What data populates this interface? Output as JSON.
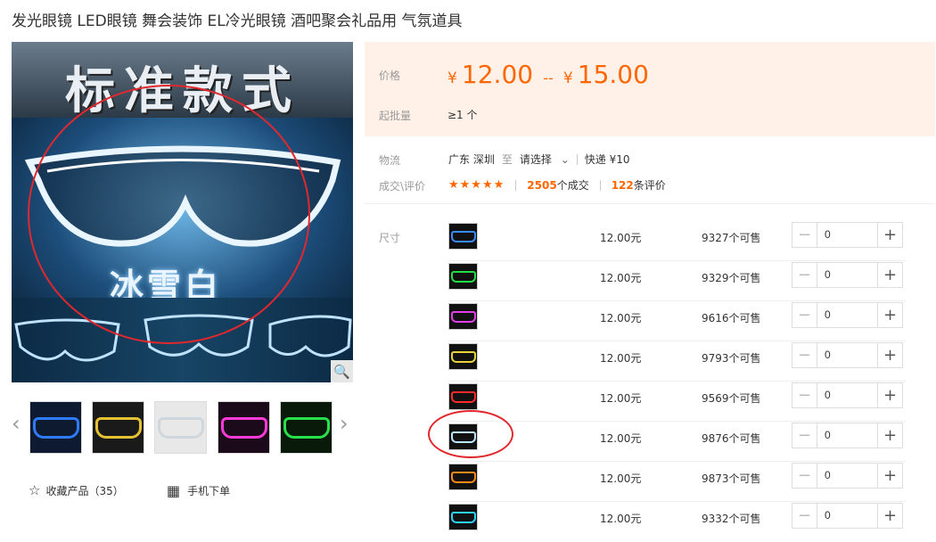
{
  "product": {
    "title": "发光眼镜 LED眼镜 舞会装饰 EL冷光眼镜 酒吧聚会礼品用 气氛道具",
    "banner_text": "标准款式",
    "variant_text": "冰雪白"
  },
  "price": {
    "label": "价格",
    "currency": "¥",
    "min": "12.00",
    "separator": "--",
    "max": "15.00"
  },
  "moq": {
    "label": "起批量",
    "value": "≥1 个"
  },
  "shipping": {
    "label": "物流",
    "origin": "广东 深圳",
    "to": "至",
    "dest": "请选择",
    "method": "快递 ¥10"
  },
  "reviews": {
    "label": "成交\\评价",
    "stars": "★★★★★",
    "deals_num": "2505",
    "deals_text": "个成交",
    "reviews_num": "122",
    "reviews_text": "条评价"
  },
  "size_label": "尺寸",
  "skus": [
    {
      "price": "12.00元",
      "stock": "9327个可售",
      "qty": "0",
      "color": "#3a8bff"
    },
    {
      "price": "12.00元",
      "stock": "9329个可售",
      "qty": "0",
      "color": "#22dd44"
    },
    {
      "price": "12.00元",
      "stock": "9616个可售",
      "qty": "0",
      "color": "#e23de8"
    },
    {
      "price": "12.00元",
      "stock": "9793个可售",
      "qty": "0",
      "color": "#e8d43a"
    },
    {
      "price": "12.00元",
      "stock": "9569个可售",
      "qty": "0",
      "color": "#ff2a2a"
    },
    {
      "price": "12.00元",
      "stock": "9876个可售",
      "qty": "0",
      "color": "#bfe6ff"
    },
    {
      "price": "12.00元",
      "stock": "9873个可售",
      "qty": "0",
      "color": "#ff8a1a"
    },
    {
      "price": "12.00元",
      "stock": "9332个可售",
      "qty": "0",
      "color": "#2ad4ff"
    }
  ],
  "thumbnails": [
    {
      "color": "#2f7bff"
    },
    {
      "color": "#e6c232"
    },
    {
      "color": "#cfd6dc"
    },
    {
      "color": "#ff3ad8"
    },
    {
      "color": "#28e04a"
    }
  ],
  "actions": {
    "favorite": "收藏产品（35）",
    "mobile": "手机下单"
  },
  "icons": {
    "minus": "−",
    "plus": "+",
    "zoom": "🔍",
    "prev": "‹",
    "next": "›",
    "star": "☆",
    "qr": "▦",
    "chevron": "⌄"
  },
  "colors": {
    "accent": "#ff6600",
    "price_bg": "#fff1e8",
    "annotation": "#e0282e"
  }
}
